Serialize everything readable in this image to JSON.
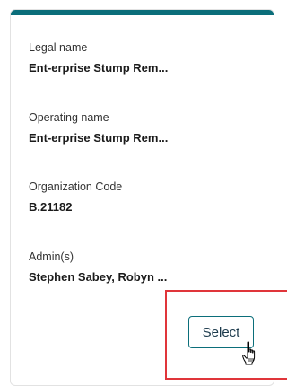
{
  "card": {
    "accent_color": "#0b6e7a",
    "legal_name": {
      "label": "Legal name",
      "value": "Ent-erprise Stump Rem..."
    },
    "operating_name": {
      "label": "Operating name",
      "value": "Ent-erprise Stump Rem..."
    },
    "organization_code": {
      "label": "Organization Code",
      "value": "B.21182"
    },
    "admins": {
      "label": "Admin(s)",
      "value": "Stephen Sabey, Robyn ..."
    },
    "select_label": "Select"
  },
  "highlight_color": "#e0353a",
  "cursor_icon": "hand-pointer-icon"
}
